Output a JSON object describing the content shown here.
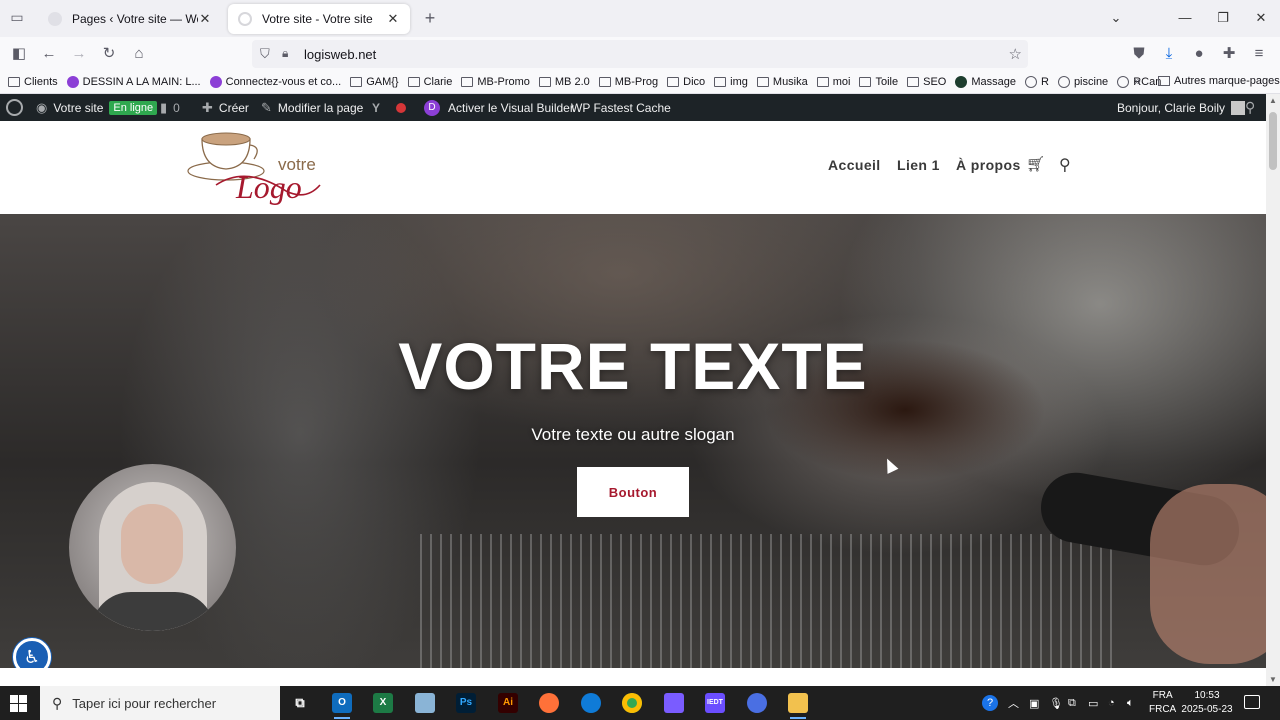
{
  "browser": {
    "tabs": [
      {
        "title": "Pages ‹ Votre site — WordPress",
        "active": false
      },
      {
        "title": "Votre site - Votre site",
        "active": true
      }
    ],
    "url": "logisweb.net",
    "bookmarks": [
      {
        "label": "Clients",
        "icon": "folder-icon"
      },
      {
        "label": "DESSIN A LA MAIN: L...",
        "icon": "bookmark-favicon"
      },
      {
        "label": "Connectez-vous et co...",
        "icon": "bookmark-favicon"
      },
      {
        "label": "GAM{}",
        "icon": "folder-icon"
      },
      {
        "label": "Clarie",
        "icon": "folder-icon"
      },
      {
        "label": "MB-Promo",
        "icon": "folder-icon"
      },
      {
        "label": "MB 2.0",
        "icon": "folder-icon"
      },
      {
        "label": "MB-Prog",
        "icon": "folder-icon"
      },
      {
        "label": "Dico",
        "icon": "folder-icon"
      },
      {
        "label": "img",
        "icon": "folder-icon"
      },
      {
        "label": "Musika",
        "icon": "folder-icon"
      },
      {
        "label": "moi",
        "icon": "folder-icon"
      },
      {
        "label": "Toile",
        "icon": "folder-icon"
      },
      {
        "label": "SEO",
        "icon": "folder-icon"
      },
      {
        "label": "Massage",
        "icon": "bookmark-favicon"
      },
      {
        "label": "R",
        "icon": "globe-icon"
      },
      {
        "label": "piscine",
        "icon": "globe-icon"
      },
      {
        "label": "RCan",
        "icon": "globe-icon"
      }
    ],
    "other_bookmarks": "Autres marque-pages"
  },
  "adminbar": {
    "site_name": "Votre site",
    "status_badge": "En ligne",
    "comment_count": "0",
    "create_label": "Créer",
    "edit_page_label": "Modifier la page",
    "visual_builder_label": "Activer le Visual Builder",
    "cache_label": "WP Fastest Cache",
    "greeting": "Bonjour, Clarie Boily"
  },
  "site": {
    "logo_small": "votre",
    "logo_big": "Logo",
    "nav": [
      "Accueil",
      "Lien 1",
      "À propos"
    ]
  },
  "hero": {
    "title": "VOTRE TEXTE",
    "subtitle": "Votre texte ou autre slogan",
    "button_label": "Bouton"
  },
  "taskbar": {
    "search_placeholder": "Taper ici pour rechercher",
    "lang_top": "FRA",
    "lang_bottom": "FRCA",
    "time": "10:53",
    "date": "2025-05-23",
    "apps": [
      "Ps",
      "Ai",
      "IEDT"
    ]
  },
  "colors": {
    "admin_bar": "#1d2327",
    "online_badge": "#2fa84f",
    "hero_button_text": "#a6192e",
    "logo_red": "#a6192e",
    "taskbar": "#1f1f1f"
  }
}
